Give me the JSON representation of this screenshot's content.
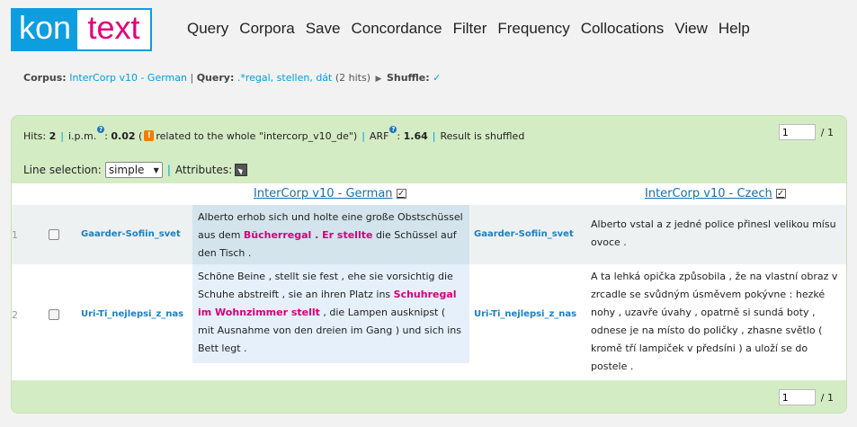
{
  "app": {
    "logo_part1": "kon",
    "logo_part2": "text"
  },
  "menu": [
    "Query",
    "Corpora",
    "Save",
    "Concordance",
    "Filter",
    "Frequency",
    "Collocations",
    "View",
    "Help"
  ],
  "breadcrumb": {
    "corpus_label": "Corpus:",
    "corpus_value": "InterCorp v10 - German",
    "separator": "|",
    "query_label": "Query",
    "query_value": ".*regal, stellen, dát",
    "hits_note": "(2 hits)",
    "shuffle_label": "Shuffle",
    "shuffle_value": "✓"
  },
  "stats": {
    "hits_label": "Hits:",
    "hits_value": "2",
    "ipm_label": "i.p.m.",
    "ipm_value": "0.02",
    "warn_symbol": "!",
    "related_text": "related to the whole \"intercorp_v10_de\")",
    "arf_label": "ARF",
    "arf_value": "1.64",
    "shuffled_text": "Result is shuffled",
    "help_symbol": "?"
  },
  "pager": {
    "page_value": "1",
    "page_total": "/ 1"
  },
  "line_selection": {
    "label": "Line selection:",
    "value": "simple",
    "attributes_label": "Attributes:"
  },
  "columns": {
    "primary": "InterCorp v10 - German",
    "aligned": "InterCorp v10 - Czech"
  },
  "rows": [
    {
      "num": "1",
      "ref": "Gaarder-Sofiin_svet",
      "kwic_before": "Alberto erhob sich und holte eine große Obstschüssel aus dem ",
      "kwic_hit": "Bücherregal . Er stellte",
      "kwic_after": " die Schüssel auf den Tisch .",
      "aligned_ref": "Gaarder-Sofiin_svet",
      "aligned_text": "Alberto vstal a z jedné police přinesl velikou mísu ovoce ."
    },
    {
      "num": "2",
      "ref": "Uri-Ti_nejlepsi_z_nas",
      "kwic_before": "Schöne Beine , stellt sie fest , ehe sie vorsichtig die Schuhe abstreift , sie an ihren Platz ins ",
      "kwic_hit": "Schuhregal im Wohnzimmer stellt",
      "kwic_after": " , die Lampen ausknipst ( mit Ausnahme von den dreien im Gang ) und sich ins Bett legt .",
      "aligned_ref": "Uri-Ti_nejlepsi_z_nas",
      "aligned_text": "A ta lehká opička způsobila , že na vlastní obraz v zrcadle se svůdným úsměvem pokývne : hezké nohy , uzavře úvahy , opatrně si sundá boty , odnese je na místo do poličky , zhasne světlo ( kromě tří lampiček v předsíni ) a uloží se do postele ."
    }
  ]
}
